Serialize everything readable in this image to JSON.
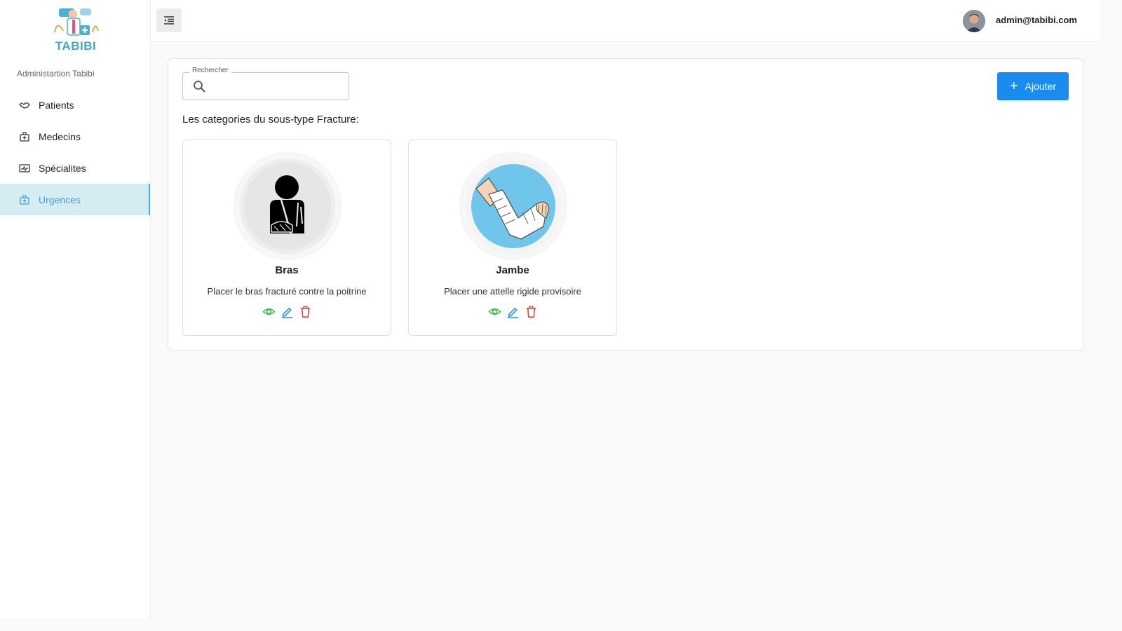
{
  "brand": {
    "name": "TABIBI",
    "subtitle": "Administartion Tabibi",
    "accent": "#3fa9c5"
  },
  "sidebar": {
    "items": [
      {
        "label": "Patients",
        "icon": "handshake-icon",
        "active": false
      },
      {
        "label": "Medecins",
        "icon": "medical-bag-icon",
        "active": false
      },
      {
        "label": "Spécialites",
        "icon": "pulse-card-icon",
        "active": false
      },
      {
        "label": "Urgences",
        "icon": "first-aid-icon",
        "active": true
      }
    ]
  },
  "header": {
    "user_email": "admin@tabibi.com"
  },
  "search": {
    "legend": "Rechercher",
    "value": ""
  },
  "toolbar": {
    "add_label": "Ajouter",
    "add_color": "#1a8cf0"
  },
  "section": {
    "title": "Les categories du sous-type Fracture:"
  },
  "categories": [
    {
      "name": "Bras",
      "description": "Placer le bras fracturé contre la poitrine"
    },
    {
      "name": "Jambe",
      "description": "Placer une attelle rigide provisoire"
    }
  ],
  "action_colors": {
    "view": "#3bb54a",
    "edit": "#1a8cf0",
    "delete": "#e53935"
  }
}
